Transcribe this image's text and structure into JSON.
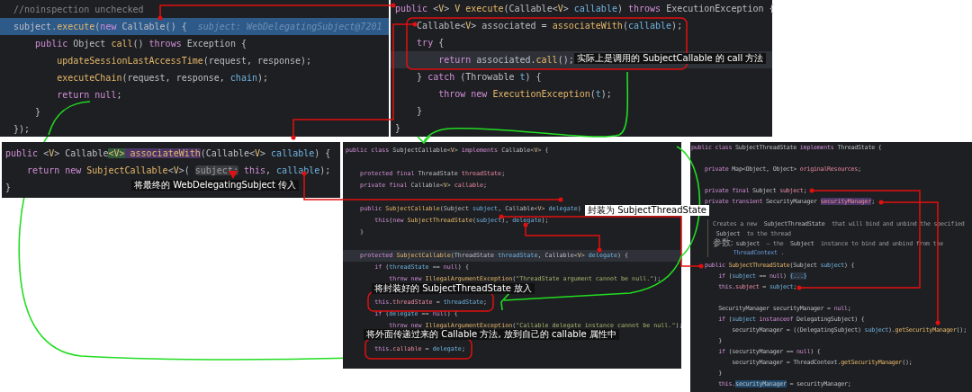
{
  "panels": [
    {
      "lines": [
        {
          "selected": false,
          "tokens": [
            {
              "text": "//noinspection unchecked",
              "kind": "comment"
            }
          ]
        },
        {
          "selected": true,
          "tokens": [
            {
              "text": "subject.",
              "kind": "plain"
            },
            {
              "text": "execute",
              "kind": "fn"
            },
            {
              "text": "(",
              "kind": "plain"
            },
            {
              "text": "new ",
              "kind": "kw"
            },
            {
              "text": "Callable() {  ",
              "kind": "plain"
            },
            {
              "text": "subject: WebDelegatingSubject@7201",
              "kind": "hint"
            }
          ]
        },
        {
          "selected": false,
          "tokens": [
            {
              "text": "    public ",
              "kind": "kw"
            },
            {
              "text": "Object ",
              "kind": "plain"
            },
            {
              "text": "call",
              "kind": "fn"
            },
            {
              "text": "() ",
              "kind": "plain"
            },
            {
              "text": "throws ",
              "kind": "kw"
            },
            {
              "text": "Exception {",
              "kind": "plain"
            }
          ]
        },
        {
          "selected": false,
          "tokens": [
            {
              "text": "        updateSessionLastAccessTime",
              "kind": "fn"
            },
            {
              "text": "(request, response);",
              "kind": "plain"
            }
          ]
        },
        {
          "selected": false,
          "tokens": [
            {
              "text": "        executeChain",
              "kind": "fn"
            },
            {
              "text": "(request, response, ",
              "kind": "plain"
            },
            {
              "text": "chain",
              "kind": "param"
            },
            {
              "text": ");",
              "kind": "plain"
            }
          ]
        },
        {
          "selected": false,
          "tokens": [
            {
              "text": "        return null",
              "kind": "kw"
            },
            {
              "text": ";",
              "kind": "plain"
            }
          ]
        },
        {
          "selected": false,
          "tokens": [
            {
              "text": "    }",
              "kind": "plain"
            }
          ]
        },
        {
          "selected": false,
          "tokens": [
            {
              "text": "});",
              "kind": "plain"
            }
          ]
        }
      ]
    },
    {
      "lines": [
        {
          "current": false,
          "tokens": [
            {
              "text": "public ",
              "kind": "kw"
            },
            {
              "text": "<",
              "kind": "plain"
            },
            {
              "text": "V",
              "kind": "gen"
            },
            {
              "text": "> ",
              "kind": "plain"
            },
            {
              "text": "V ",
              "kind": "gen"
            },
            {
              "text": "execute",
              "kind": "fn"
            },
            {
              "text": "(Callable<",
              "kind": "plain"
            },
            {
              "text": "V",
              "kind": "gen"
            },
            {
              "text": "> ",
              "kind": "plain"
            },
            {
              "text": "callable",
              "kind": "param"
            },
            {
              "text": ") ",
              "kind": "plain"
            },
            {
              "text": "throws ",
              "kind": "kw"
            },
            {
              "text": "ExecutionException {",
              "kind": "plain"
            }
          ]
        },
        {
          "current": false,
          "tokens": [
            {
              "text": "    Callable<",
              "kind": "plain"
            },
            {
              "text": "V",
              "kind": "gen"
            },
            {
              "text": "> associated = ",
              "kind": "plain"
            },
            {
              "text": "associateWith",
              "kind": "fn"
            },
            {
              "text": "(",
              "kind": "plain"
            },
            {
              "text": "callable",
              "kind": "param"
            },
            {
              "text": ");",
              "kind": "plain"
            }
          ]
        },
        {
          "current": false,
          "tokens": [
            {
              "text": "    try ",
              "kind": "kw"
            },
            {
              "text": "{",
              "kind": "plain"
            }
          ]
        },
        {
          "current": true,
          "tokens": [
            {
              "text": "        return ",
              "kind": "kw"
            },
            {
              "text": "associated.",
              "kind": "plain"
            },
            {
              "text": "call",
              "kind": "fn"
            },
            {
              "text": "();",
              "kind": "plain"
            }
          ]
        },
        {
          "current": false,
          "tokens": [
            {
              "text": "    } ",
              "kind": "plain"
            },
            {
              "text": "catch ",
              "kind": "kw"
            },
            {
              "text": "(Throwable ",
              "kind": "plain"
            },
            {
              "text": "t",
              "kind": "param"
            },
            {
              "text": ") {",
              "kind": "plain"
            }
          ]
        },
        {
          "current": false,
          "tokens": [
            {
              "text": "        throw new ",
              "kind": "kw"
            },
            {
              "text": "ExecutionException",
              "kind": "fn"
            },
            {
              "text": "(",
              "kind": "plain"
            },
            {
              "text": "t",
              "kind": "param"
            },
            {
              "text": ");",
              "kind": "plain"
            }
          ]
        },
        {
          "current": false,
          "tokens": [
            {
              "text": "    }",
              "kind": "plain"
            }
          ]
        },
        {
          "current": false,
          "tokens": [
            {
              "text": "}",
              "kind": "plain"
            }
          ]
        }
      ]
    },
    {
      "lines": [
        {
          "tokens": [
            {
              "text": "public ",
              "kind": "kw"
            },
            {
              "text": "<",
              "kind": "plain"
            },
            {
              "text": "V",
              "kind": "gen"
            },
            {
              "text": "> Callable",
              "kind": "plain"
            },
            {
              "text": "<V>",
              "kind": "match"
            },
            {
              "text": " associateWith",
              "kind": "fnhl"
            },
            {
              "text": "(Callable<",
              "kind": "plain"
            },
            {
              "text": "V",
              "kind": "gen"
            },
            {
              "text": "> ",
              "kind": "plain"
            },
            {
              "text": "callable",
              "kind": "param"
            },
            {
              "text": ") {",
              "kind": "plain"
            }
          ]
        },
        {
          "tokens": [
            {
              "text": "    return new ",
              "kind": "kw"
            },
            {
              "text": "SubjectCallable",
              "kind": "fn"
            },
            {
              "text": "<",
              "kind": "plain"
            },
            {
              "text": "V",
              "kind": "gen"
            },
            {
              "text": ">( ",
              "kind": "plain"
            },
            {
              "text": "subject:",
              "kind": "chip"
            },
            {
              "text": " this",
              "kind": "kw"
            },
            {
              "text": ", ",
              "kind": "plain"
            },
            {
              "text": "callable",
              "kind": "param"
            },
            {
              "text": ");",
              "kind": "plain"
            }
          ]
        },
        {
          "tokens": [
            {
              "text": "}",
              "kind": "plain"
            }
          ]
        }
      ]
    },
    {
      "lines": [
        {
          "kind": "code",
          "current": false,
          "tokens": [
            {
              "text": "public class ",
              "kind": "kw"
            },
            {
              "text": "SubjectCallable<",
              "kind": "plain"
            },
            {
              "text": "V",
              "kind": "gen"
            },
            {
              "text": "> ",
              "kind": "plain"
            },
            {
              "text": "implements ",
              "kind": "kw"
            },
            {
              "text": "Callable<",
              "kind": "plain"
            },
            {
              "text": "V",
              "kind": "gen"
            },
            {
              "text": "> {",
              "kind": "plain"
            }
          ]
        },
        {
          "kind": "blank",
          "current": false
        },
        {
          "kind": "code",
          "current": false,
          "tokens": [
            {
              "text": "    protected final ",
              "kind": "kw"
            },
            {
              "text": "ThreadState ",
              "kind": "plain"
            },
            {
              "text": "threadState",
              "kind": "field"
            },
            {
              "text": ";",
              "kind": "plain"
            }
          ]
        },
        {
          "kind": "code",
          "current": false,
          "tokens": [
            {
              "text": "    private final ",
              "kind": "kw"
            },
            {
              "text": "Callable<",
              "kind": "plain"
            },
            {
              "text": "V",
              "kind": "gen"
            },
            {
              "text": "> ",
              "kind": "plain"
            },
            {
              "text": "callable",
              "kind": "field"
            },
            {
              "text": ";",
              "kind": "plain"
            }
          ]
        },
        {
          "kind": "blank",
          "current": false
        },
        {
          "kind": "code",
          "current": false,
          "tokens": [
            {
              "text": "    public ",
              "kind": "kw"
            },
            {
              "text": "SubjectCallable",
              "kind": "fn"
            },
            {
              "text": "(Subject ",
              "kind": "plain"
            },
            {
              "text": "subject",
              "kind": "param"
            },
            {
              "text": ", Callable<",
              "kind": "plain"
            },
            {
              "text": "V",
              "kind": "gen"
            },
            {
              "text": "> ",
              "kind": "plain"
            },
            {
              "text": "delegate",
              "kind": "param"
            },
            {
              "text": ")",
              "kind": "plain"
            }
          ]
        },
        {
          "kind": "code",
          "current": false,
          "tokens": [
            {
              "text": "        this",
              "kind": "kw"
            },
            {
              "text": "(",
              "kind": "plain"
            },
            {
              "text": "new ",
              "kind": "kw"
            },
            {
              "text": "SubjectThreadState",
              "kind": "fn"
            },
            {
              "text": "(",
              "kind": "plain"
            },
            {
              "text": "subject",
              "kind": "param"
            },
            {
              "text": "), ",
              "kind": "plain"
            },
            {
              "text": "delegate",
              "kind": "param"
            },
            {
              "text": ");",
              "kind": "plain"
            }
          ]
        },
        {
          "kind": "code",
          "current": false,
          "tokens": [
            {
              "text": "    }",
              "kind": "plain"
            }
          ]
        },
        {
          "kind": "blank",
          "current": false
        },
        {
          "kind": "code",
          "current": true,
          "tokens": [
            {
              "text": "    protected ",
              "kind": "kw"
            },
            {
              "text": "SubjectCallable",
              "kind": "fn"
            },
            {
              "text": "(ThreadState ",
              "kind": "plain"
            },
            {
              "text": "threadState",
              "kind": "param"
            },
            {
              "text": ", Callable<",
              "kind": "plain"
            },
            {
              "text": "V",
              "kind": "gen"
            },
            {
              "text": "> ",
              "kind": "plain"
            },
            {
              "text": "delegate",
              "kind": "param"
            },
            {
              "text": ") {",
              "kind": "plain"
            }
          ]
        },
        {
          "kind": "code",
          "current": false,
          "tokens": [
            {
              "text": "        if ",
              "kind": "kw"
            },
            {
              "text": "(",
              "kind": "plain"
            },
            {
              "text": "threadState",
              "kind": "param"
            },
            {
              "text": " == ",
              "kind": "plain"
            },
            {
              "text": "null",
              "kind": "kw"
            },
            {
              "text": ") {",
              "kind": "plain"
            }
          ]
        },
        {
          "kind": "code",
          "current": false,
          "tokens": [
            {
              "text": "            throw new ",
              "kind": "kw"
            },
            {
              "text": "IllegalArgumentException",
              "kind": "fn"
            },
            {
              "text": "(",
              "kind": "plain"
            },
            {
              "text": "\"ThreadState argument cannot be null.\"",
              "kind": "str"
            },
            {
              "text": ");",
              "kind": "plain"
            }
          ]
        },
        {
          "kind": "blank",
          "current": false
        },
        {
          "kind": "code",
          "current": false,
          "tokens": [
            {
              "text": "        this",
              "kind": "kw"
            },
            {
              "text": ".",
              "kind": "plain"
            },
            {
              "text": "threadState",
              "kind": "field"
            },
            {
              "text": " = ",
              "kind": "plain"
            },
            {
              "text": "threadState",
              "kind": "param"
            },
            {
              "text": ";",
              "kind": "plain"
            }
          ]
        },
        {
          "kind": "code",
          "current": false,
          "tokens": [
            {
              "text": "        if ",
              "kind": "kw"
            },
            {
              "text": "(",
              "kind": "plain"
            },
            {
              "text": "delegate",
              "kind": "param"
            },
            {
              "text": " == ",
              "kind": "plain"
            },
            {
              "text": "null",
              "kind": "kw"
            },
            {
              "text": ") {",
              "kind": "plain"
            }
          ]
        },
        {
          "kind": "code",
          "current": false,
          "tokens": [
            {
              "text": "            throw new ",
              "kind": "kw"
            },
            {
              "text": "IllegalArgumentException",
              "kind": "fn"
            },
            {
              "text": "(",
              "kind": "plain"
            },
            {
              "text": "\"Callable delegate instance cannot be null.\"",
              "kind": "str"
            },
            {
              "text": ");",
              "kind": "plain"
            }
          ]
        },
        {
          "kind": "blank",
          "current": false
        },
        {
          "kind": "code",
          "current": false,
          "tokens": [
            {
              "text": "        this",
              "kind": "kw"
            },
            {
              "text": ".",
              "kind": "plain"
            },
            {
              "text": "callable",
              "kind": "field"
            },
            {
              "text": " = ",
              "kind": "plain"
            },
            {
              "text": "delegate",
              "kind": "param"
            },
            {
              "text": ";",
              "kind": "plain"
            }
          ]
        }
      ]
    },
    {
      "lines": [
        {
          "kind": "code",
          "tokens": [
            {
              "text": "public class ",
              "kind": "kw"
            },
            {
              "text": "SubjectThreadState ",
              "kind": "plain"
            },
            {
              "text": "implements ",
              "kind": "kw"
            },
            {
              "text": "ThreadState {",
              "kind": "plain"
            }
          ]
        },
        {
          "kind": "blank"
        },
        {
          "kind": "code",
          "tokens": [
            {
              "text": "    private ",
              "kind": "kw"
            },
            {
              "text": "Map<Object, Object> ",
              "kind": "plain"
            },
            {
              "text": "originalResources",
              "kind": "field"
            },
            {
              "text": ";",
              "kind": "plain"
            }
          ]
        },
        {
          "kind": "blank"
        },
        {
          "kind": "code",
          "tokens": [
            {
              "text": "    private final ",
              "kind": "kw"
            },
            {
              "text": "Subject ",
              "kind": "plain"
            },
            {
              "text": "subject",
              "kind": "field"
            },
            {
              "text": ";",
              "kind": "plain"
            }
          ]
        },
        {
          "kind": "code",
          "tokens": [
            {
              "text": "    private transient ",
              "kind": "kw"
            },
            {
              "text": "SecurityManager ",
              "kind": "plain"
            },
            {
              "text": "securityManager",
              "kind": "fieldhl"
            },
            {
              "text": ";",
              "kind": "plain"
            }
          ]
        },
        {
          "kind": "blank"
        },
        {
          "kind": "doc",
          "tokens": [
            {
              "text": "Creates a new  ",
              "kind": "doc"
            },
            {
              "text": "SubjectThreadState",
              "kind": "doccode"
            },
            {
              "text": "  that will bind and unbind the specified",
              "kind": "doc"
            }
          ]
        },
        {
          "kind": "doc",
          "tokens": [
            {
              "text": " Subject",
              "kind": "doccode"
            },
            {
              "text": "  to the thread",
              "kind": "doc"
            }
          ]
        },
        {
          "kind": "doc",
          "tokens": [
            {
              "text": "参数: ",
              "kind": "doclabel"
            },
            {
              "text": "subject",
              "kind": "doccode"
            },
            {
              "text": "  – the  ",
              "kind": "doc"
            },
            {
              "text": "Subject",
              "kind": "doccode"
            },
            {
              "text": "  instance to bind and unbind from the",
              "kind": "doc"
            }
          ]
        },
        {
          "kind": "doc",
          "tokens": [
            {
              "text": "      ThreadContext",
              "kind": "doclink"
            },
            {
              "text": " .",
              "kind": "doc"
            }
          ]
        },
        {
          "kind": "code",
          "tokens": [
            {
              "text": "    public ",
              "kind": "kw"
            },
            {
              "text": "SubjectThreadState",
              "kind": "fn"
            },
            {
              "text": "(Subject ",
              "kind": "plain"
            },
            {
              "text": "subject",
              "kind": "param"
            },
            {
              "text": ") {",
              "kind": "plain"
            }
          ]
        },
        {
          "kind": "code",
          "tokens": [
            {
              "text": "        if ",
              "kind": "kw"
            },
            {
              "text": "(",
              "kind": "plain"
            },
            {
              "text": "subject",
              "kind": "param"
            },
            {
              "text": " == ",
              "kind": "plain"
            },
            {
              "text": "null",
              "kind": "kw"
            },
            {
              "text": ") ",
              "kind": "plain"
            },
            {
              "text": "{...}",
              "kind": "fold"
            }
          ]
        },
        {
          "kind": "code",
          "tokens": [
            {
              "text": "        this",
              "kind": "kw"
            },
            {
              "text": ".",
              "kind": "plain"
            },
            {
              "text": "subject",
              "kind": "field"
            },
            {
              "text": " = ",
              "kind": "plain"
            },
            {
              "text": "subject",
              "kind": "param"
            },
            {
              "text": ";",
              "kind": "plain"
            }
          ]
        },
        {
          "kind": "blank"
        },
        {
          "kind": "code",
          "tokens": [
            {
              "text": "        SecurityManager securityManager = ",
              "kind": "plain"
            },
            {
              "text": "null",
              "kind": "kw"
            },
            {
              "text": ";",
              "kind": "plain"
            }
          ]
        },
        {
          "kind": "code",
          "tokens": [
            {
              "text": "        if ",
              "kind": "kw"
            },
            {
              "text": "(",
              "kind": "plain"
            },
            {
              "text": "subject",
              "kind": "param"
            },
            {
              "text": " instanceof ",
              "kind": "kw"
            },
            {
              "text": "DelegatingSubject) {",
              "kind": "plain"
            }
          ]
        },
        {
          "kind": "code",
          "tokens": [
            {
              "text": "            securityManager = ((DelegatingSubject) ",
              "kind": "plain"
            },
            {
              "text": "subject",
              "kind": "param"
            },
            {
              "text": ").",
              "kind": "plain"
            },
            {
              "text": "getSecurityManager",
              "kind": "fn"
            },
            {
              "text": "();",
              "kind": "plain"
            }
          ]
        },
        {
          "kind": "code",
          "tokens": [
            {
              "text": "        }",
              "kind": "plain"
            }
          ]
        },
        {
          "kind": "code",
          "tokens": [
            {
              "text": "        if ",
              "kind": "kw"
            },
            {
              "text": "(securityManager == ",
              "kind": "plain"
            },
            {
              "text": "null",
              "kind": "kw"
            },
            {
              "text": ") {",
              "kind": "plain"
            }
          ]
        },
        {
          "kind": "code",
          "tokens": [
            {
              "text": "            securityManager = ThreadContext.",
              "kind": "plain"
            },
            {
              "text": "getSecurityManager",
              "kind": "fn"
            },
            {
              "text": "();",
              "kind": "plain"
            }
          ]
        },
        {
          "kind": "code",
          "tokens": [
            {
              "text": "        }",
              "kind": "plain"
            }
          ]
        },
        {
          "kind": "code",
          "tokens": [
            {
              "text": "        this",
              "kind": "kw"
            },
            {
              "text": ".",
              "kind": "plain"
            },
            {
              "text": "securityManager",
              "kind": "refhl"
            },
            {
              "text": " = securityManager;",
              "kind": "plain"
            }
          ]
        }
      ]
    }
  ],
  "annotations": [
    {
      "text": "实际上是调用的 SubjectCallable 的 call 方法",
      "kind": "dark"
    },
    {
      "text": "将最终的 WebDelegatingSubject 传入",
      "kind": "dark"
    },
    {
      "text": "封装为 SubjectThreadState",
      "kind": "light"
    },
    {
      "text": "将封装好的 SubjectThreadState 放入",
      "kind": "dark"
    },
    {
      "text": "将外面传递过来的 Callable 方法, 放到自己的 callable 属性中",
      "kind": "dark"
    }
  ]
}
